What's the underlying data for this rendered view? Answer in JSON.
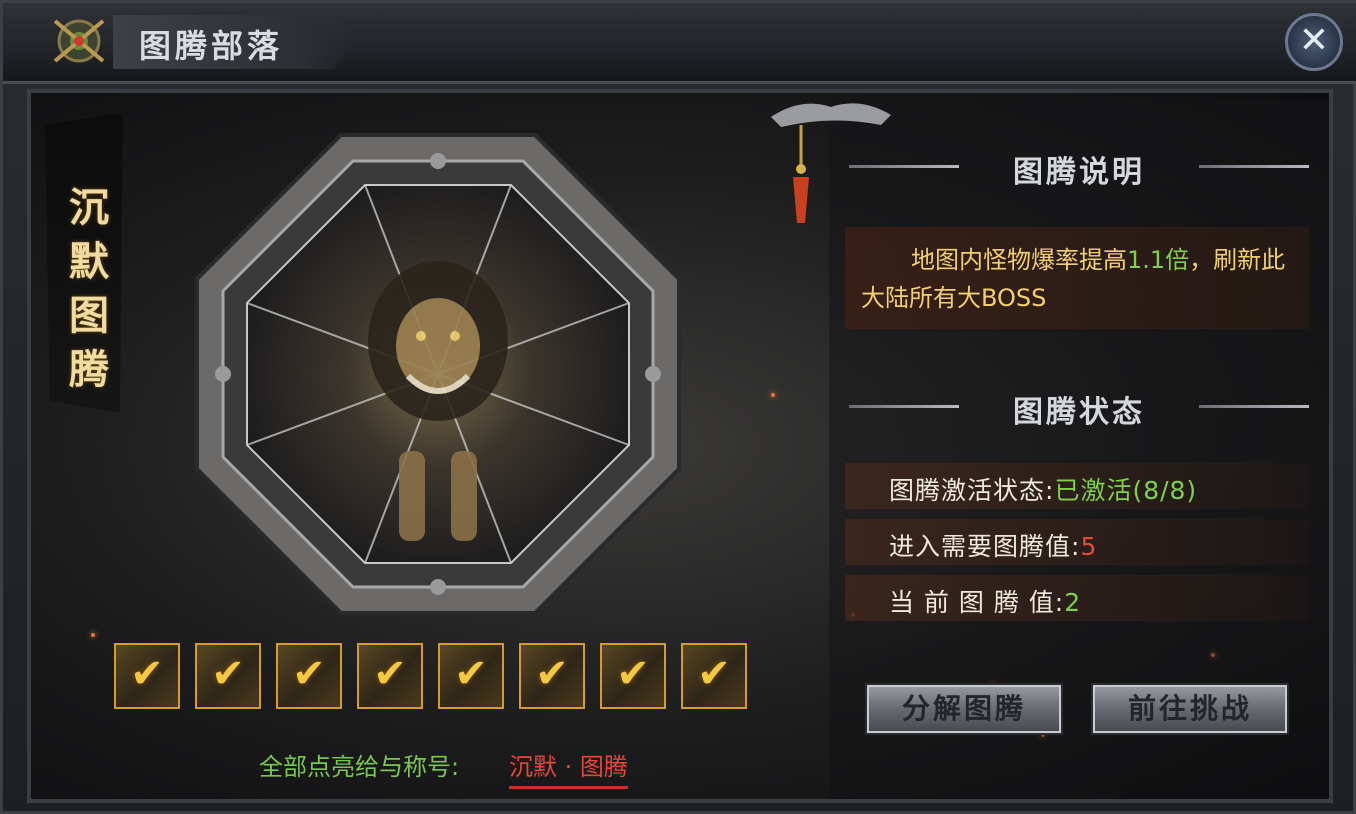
{
  "window": {
    "title": "图腾部落",
    "close_icon": "close-icon"
  },
  "banner": {
    "name_lines": [
      "沉",
      "默",
      "图",
      "腾"
    ]
  },
  "description": {
    "header": "图腾说明",
    "text_before": "地图内怪物爆率提高",
    "highlight": "1.1倍",
    "text_after": "，刷新此大陆所有大BOSS"
  },
  "status": {
    "header": "图腾状态",
    "rows": [
      {
        "label": "图腾激活状态:",
        "value": "已激活(8/8)",
        "value_color": "#7fd148"
      },
      {
        "label": "进入需要图腾值:",
        "value": "5",
        "value_color": "#e84638"
      },
      {
        "label": "当 前 图 腾 值:",
        "value": "2",
        "value_color": "#7fd148"
      }
    ]
  },
  "checks": {
    "count": 8,
    "activated": 8,
    "mark": "✔"
  },
  "reward": {
    "label": "全部点亮给与称号:",
    "title": "沉默 · 图腾"
  },
  "buttons": {
    "decompose": "分解图腾",
    "challenge": "前往挑战"
  },
  "colors": {
    "gold": "#f2d070",
    "green": "#7fd148",
    "red": "#e84638",
    "checkbox_border": "#d59b2c"
  }
}
